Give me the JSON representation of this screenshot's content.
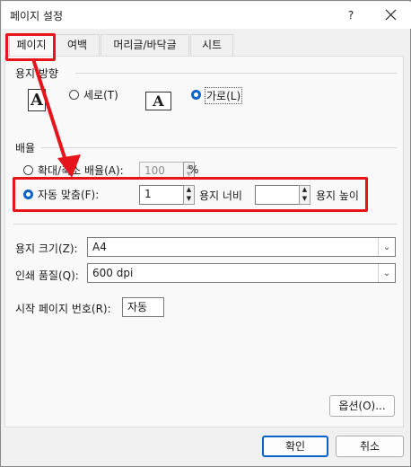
{
  "window": {
    "title": "페이지 설정",
    "help": "?"
  },
  "tabs": [
    {
      "label": "페이지"
    },
    {
      "label": "여백"
    },
    {
      "label": "머리글/바닥글"
    },
    {
      "label": "시트"
    }
  ],
  "orientation": {
    "heading": "용지 방향",
    "portrait_label": "세로(T)",
    "landscape_label": "가로(L)",
    "icon_letter": "A",
    "selected": "landscape"
  },
  "scaling": {
    "heading": "배율",
    "adjust_label": "확대/축소 배율(A):",
    "adjust_value": "100",
    "percent": "%",
    "fit_label": "자동 맞춤(F):",
    "fit_wide_value": "1",
    "pages_wide": "용지 너비",
    "fit_tall_value": "",
    "pages_tall": "용지 높이",
    "selected": "fit"
  },
  "paper": {
    "size_label": "용지 크기(Z):",
    "size_value": "A4",
    "quality_label": "인쇄 품질(Q):",
    "quality_value": "600 dpi",
    "first_page_label": "시작 페이지 번호(R):",
    "first_page_value": "자동"
  },
  "buttons": {
    "options": "옵션(O)...",
    "ok": "확인",
    "cancel": "취소"
  },
  "colors": {
    "accent": "#0a62c9",
    "annotation": "#e8141b"
  }
}
